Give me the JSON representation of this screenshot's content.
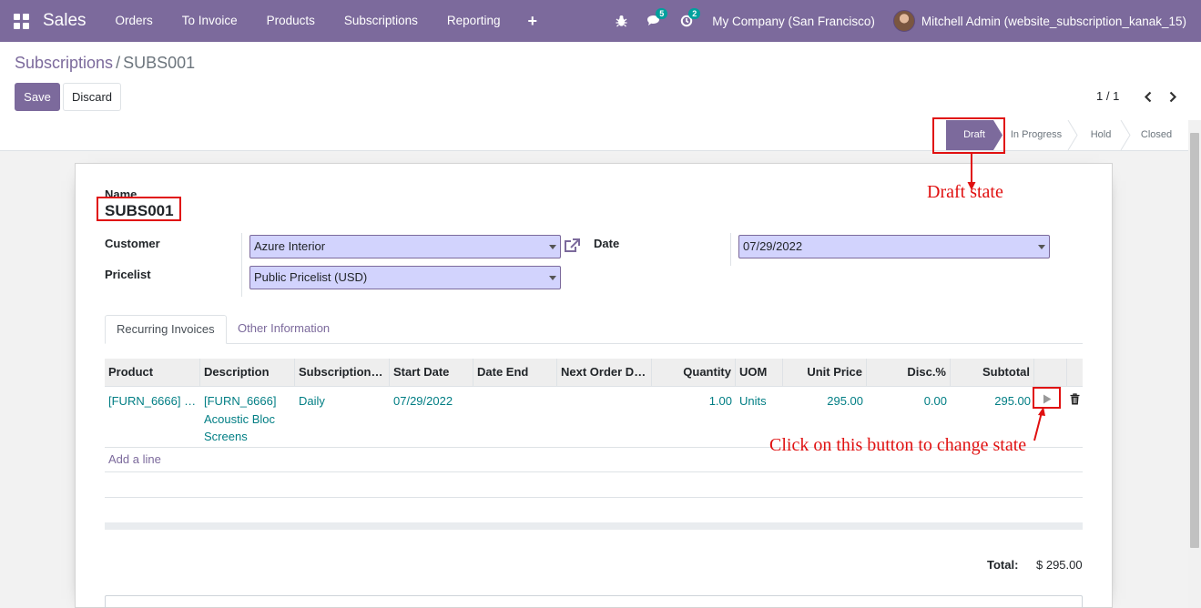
{
  "navbar": {
    "brand": "Sales",
    "menu": [
      "Orders",
      "To Invoice",
      "Products",
      "Subscriptions",
      "Reporting"
    ],
    "plus_symbol": "+",
    "messages_count": "5",
    "activities_count": "2",
    "company": "My Company (San Francisco)",
    "user": "Mitchell Admin (website_subscription_kanak_15)"
  },
  "breadcrumb": {
    "parent": "Subscriptions",
    "separator": "/",
    "current": "SUBS001"
  },
  "buttons": {
    "save": "Save",
    "discard": "Discard"
  },
  "pager": {
    "value": "1 / 1"
  },
  "statusbar": {
    "stages": [
      "Draft",
      "In Progress",
      "Hold",
      "Closed"
    ],
    "active": "Draft"
  },
  "form": {
    "name_label": "Name",
    "name_value": "SUBS001",
    "customer_label": "Customer",
    "customer_value": "Azure Interior",
    "pricelist_label": "Pricelist",
    "pricelist_value": "Public Pricelist (USD)",
    "date_label": "Date",
    "date_value": "07/29/2022"
  },
  "tabs": [
    "Recurring Invoices",
    "Other Information"
  ],
  "table": {
    "columns": [
      "Product",
      "Description",
      "Subscription…",
      "Start Date",
      "Date End",
      "Next Order D…",
      "Quantity",
      "UOM",
      "Unit Price",
      "Disc.%",
      "Subtotal"
    ],
    "rows": [
      {
        "product": "[FURN_6666] …",
        "description_lines": [
          "[FURN_6666]",
          "Acoustic Bloc",
          "Screens"
        ],
        "subscription": "Daily",
        "start_date": "07/29/2022",
        "date_end": "",
        "next_order": "",
        "quantity": "1.00",
        "uom": "Units",
        "unit_price": "295.00",
        "discount": "0.00",
        "subtotal": "295.00"
      }
    ],
    "add_line": "Add a line"
  },
  "total": {
    "label": "Total:",
    "value": "$ 295.00"
  },
  "annotations": {
    "draft_state": "Draft state",
    "click_hint": "Click on this button to change state"
  },
  "colors": {
    "brand": "#7c6a9c",
    "link": "#017e84",
    "annotation": "#e01010",
    "field_bg": "#d2d3fd"
  }
}
